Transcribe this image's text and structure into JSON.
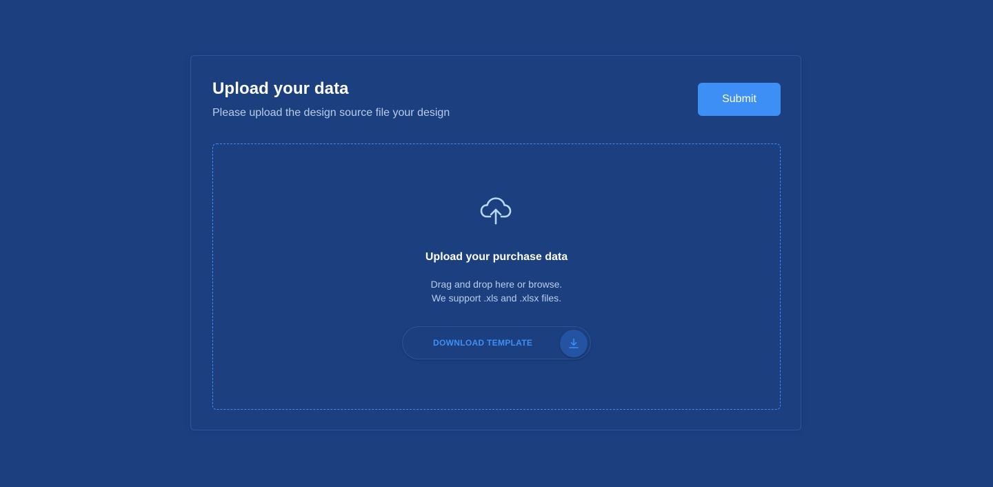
{
  "header": {
    "title": "Upload your data",
    "subtitle": "Please upload the design source file your design",
    "submit_label": "Submit"
  },
  "dropzone": {
    "icon": "cloud-upload-icon",
    "heading": "Upload your purchase data",
    "help_line_1": "Drag and drop here or browse.",
    "help_line_2": "We support .xls and .xlsx files.",
    "download_label": "DOWNLOAD TEMPLATE",
    "download_icon": "download-icon"
  },
  "colors": {
    "background": "#1c3f7f",
    "accent": "#3d8ff5",
    "text_primary": "#ffffff",
    "text_secondary": "#b9cdeb"
  }
}
